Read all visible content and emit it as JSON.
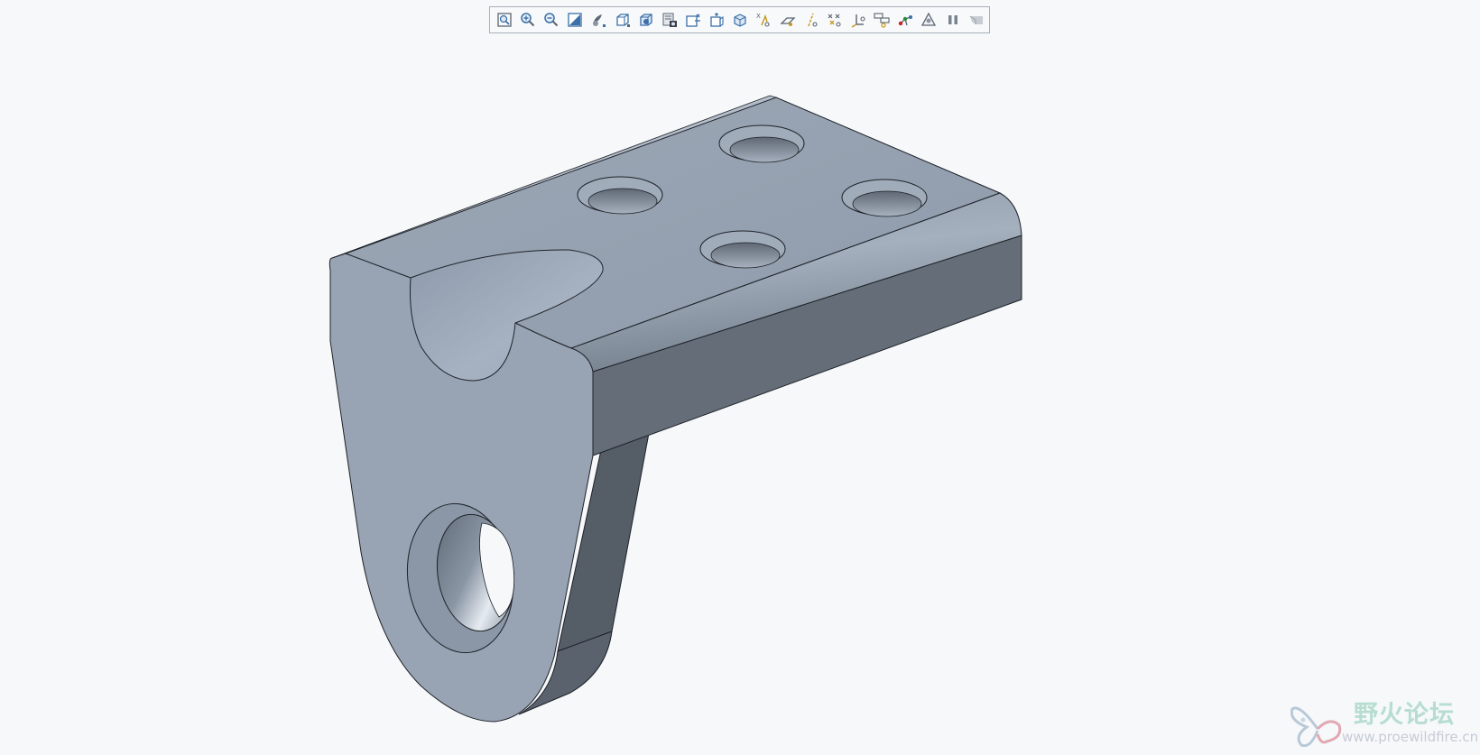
{
  "toolbar": {
    "buttons": [
      {
        "name": "refit-icon"
      },
      {
        "name": "zoom-in-icon"
      },
      {
        "name": "zoom-out-icon"
      },
      {
        "name": "repaint-icon"
      },
      {
        "name": "display-style-icon"
      },
      {
        "name": "saved-orientations-icon"
      },
      {
        "name": "view-manager-icon"
      },
      {
        "name": "appearance-gallery-icon"
      },
      {
        "name": "section-icon"
      },
      {
        "name": "perspective-view-icon"
      },
      {
        "name": "spin-center-icon"
      },
      {
        "name": "annotation-display-icon"
      },
      {
        "name": "plane-display-icon"
      },
      {
        "name": "axis-display-icon"
      },
      {
        "name": "point-display-icon"
      },
      {
        "name": "csys-display-icon"
      },
      {
        "name": "view-normal-icon"
      },
      {
        "name": "skeleton-icon"
      },
      {
        "name": "render-icon"
      },
      {
        "name": "pause-icon"
      },
      {
        "name": "disabled-flag-icon"
      }
    ]
  },
  "colors": {
    "background": "#f6f8fa",
    "part_top": "#939faf",
    "part_side": "#646d78",
    "part_dark": "#555d67",
    "edge": "#1e2228"
  },
  "watermark": {
    "title": "野火论坛",
    "url": "www.proewildfire.cn"
  }
}
